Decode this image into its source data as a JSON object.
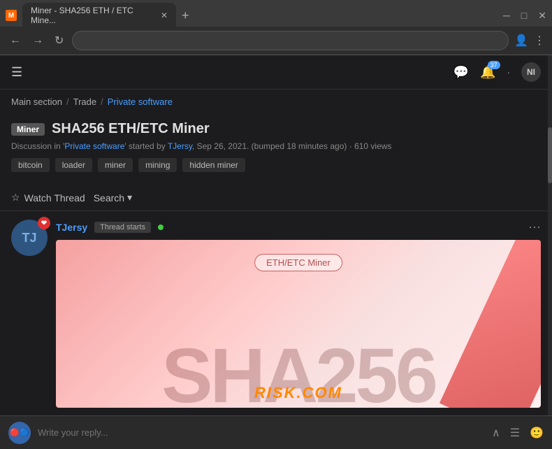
{
  "browser": {
    "tab_title": "Miner - SHA256 ETH / ETC Mine...",
    "tab_icon": "M",
    "address": "",
    "new_tab_label": "+",
    "back_label": "←",
    "forward_label": "→",
    "reload_label": "↻"
  },
  "topnav": {
    "notification_count": "37",
    "user_initials": "NI"
  },
  "breadcrumb": {
    "main": "Main section",
    "sep1": "/",
    "trade": "Trade",
    "sep2": "/",
    "active": "Private software"
  },
  "thread": {
    "badge": "Miner",
    "title": "SHA256 ETH/ETC Miner",
    "meta": "Discussion in 'Private software' started by TJersy, Sep 26, 2021. (bumped 18 minutes ago)  · 610 views",
    "meta_link1": "Private software",
    "meta_link2": "TJersy"
  },
  "tags": [
    {
      "label": "bitcoin"
    },
    {
      "label": "loader"
    },
    {
      "label": "miner"
    },
    {
      "label": "mining"
    },
    {
      "label": "hidden miner"
    }
  ],
  "actions": {
    "watch_label": "Watch Thread",
    "search_label": "Search",
    "dropdown_icon": "▾",
    "star_icon": "☆"
  },
  "post": {
    "username": "TJersy",
    "badge": "Thread starts",
    "avatar_text": "TJ",
    "more_icon": "···"
  },
  "banner": {
    "label": "ETH/ETC Miner",
    "sha_text": "SHA256",
    "watermark": "RISK.COM"
  },
  "reply": {
    "placeholder": "Write your reply...",
    "avatar_text": ""
  }
}
